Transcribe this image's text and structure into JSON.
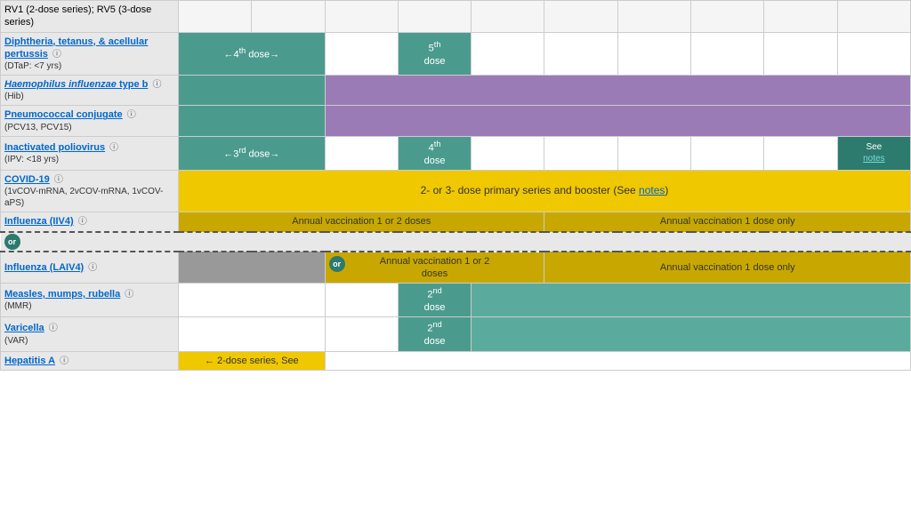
{
  "rows": [
    {
      "id": "rv",
      "nameHtml": "RV1 (2-dose series); RV5 (3-dose series)",
      "nameLink": false,
      "cells": []
    },
    {
      "id": "dtap",
      "nameLink": "Diphtheria, tetanus, & acellular pertussis",
      "nameSub": "(DTaP: <7 yrs)",
      "infoIcon": true,
      "cells": [
        {
          "col": 2,
          "colspan": 2,
          "text": "←4th dose→",
          "class": "teal"
        },
        {
          "col": 4,
          "colspan": 1,
          "text": "",
          "class": "white-cell"
        },
        {
          "col": 5,
          "colspan": 1,
          "text": "5th\ndose",
          "class": "teal"
        },
        {
          "col": 6,
          "colspan": 5,
          "text": "",
          "class": "white-cell"
        }
      ]
    },
    {
      "id": "hib",
      "nameLink": "Haemophilus influenzae type b",
      "nameSub": "(Hib)",
      "infoIcon": true,
      "cells": [
        {
          "col": 2,
          "colspan": 2,
          "text": "",
          "class": "teal"
        },
        {
          "col": 4,
          "colspan": 7,
          "text": "",
          "class": "purple"
        }
      ]
    },
    {
      "id": "pcv",
      "nameLink": "Pneumococcal conjugate",
      "nameSub": "(PCV13, PCV15)",
      "infoIcon": true,
      "cells": [
        {
          "col": 2,
          "colspan": 2,
          "text": "",
          "class": "teal"
        },
        {
          "col": 4,
          "colspan": 7,
          "text": "",
          "class": "purple"
        }
      ]
    },
    {
      "id": "ipv",
      "nameLink": "Inactivated poliovirus",
      "nameSub": "(IPV: <18 yrs)",
      "infoIcon": true,
      "cells": [
        {
          "col": 2,
          "colspan": 2,
          "text": "←3rd dose→",
          "class": "teal"
        },
        {
          "col": 4,
          "colspan": 1,
          "text": "",
          "class": "white-cell"
        },
        {
          "col": 5,
          "colspan": 1,
          "text": "4th\ndose",
          "class": "teal"
        },
        {
          "col": 6,
          "colspan": 4,
          "text": "",
          "class": "white-cell"
        },
        {
          "col": 10,
          "colspan": 1,
          "text": "See\nnotes",
          "class": "teal-dark see-notes-cell"
        }
      ]
    },
    {
      "id": "covid",
      "nameLink": "COVID-19",
      "nameSub": "(1vCOV-mRNA, 2vCOV-mRNA, 1vCOV-aPS)",
      "infoIcon": true,
      "cells": [
        {
          "col": 2,
          "colspan": 9,
          "text": "2- or 3- dose primary series and booster (See notes)",
          "class": "yellow"
        }
      ]
    },
    {
      "id": "influenza-iiv4",
      "nameLink": "Influenza (IIV4)",
      "nameSub": "",
      "infoIcon": true,
      "dotted_bottom": true,
      "cells": [
        {
          "col": 2,
          "colspan": 5,
          "text": "Annual vaccination 1 or 2 doses",
          "class": "yellow-dark"
        },
        {
          "col": 7,
          "colspan": 4,
          "text": "Annual vaccination 1 dose only",
          "class": "yellow-dark"
        }
      ]
    },
    {
      "id": "or-row",
      "isOr": true
    },
    {
      "id": "influenza-laiv4",
      "nameLink": "Influenza (LAIV4)",
      "nameSub": "",
      "infoIcon": true,
      "dotted_top": true,
      "cells": [
        {
          "col": 2,
          "colspan": 2,
          "text": "",
          "class": "gray"
        },
        {
          "col": 4,
          "colspan": 3,
          "text": "Annual vaccination 1 or 2\ndoses",
          "class": "yellow-dark",
          "orBadge": true
        },
        {
          "col": 7,
          "colspan": 4,
          "text": "Annual vaccination 1 dose only",
          "class": "yellow-dark"
        }
      ]
    },
    {
      "id": "mmr",
      "nameLink": "Measles, mumps, rubella",
      "nameSub": "(MMR)",
      "infoIcon": true,
      "cells": [
        {
          "col": 2,
          "colspan": 2,
          "text": "",
          "class": "white-cell"
        },
        {
          "col": 4,
          "colspan": 1,
          "text": "",
          "class": "white-cell"
        },
        {
          "col": 5,
          "colspan": 1,
          "text": "2nd\ndose",
          "class": "teal"
        },
        {
          "col": 6,
          "colspan": 5,
          "text": "",
          "class": "teal-light"
        }
      ]
    },
    {
      "id": "varicella",
      "nameLink": "Varicella",
      "nameSub": "(VAR)",
      "infoIcon": true,
      "cells": [
        {
          "col": 2,
          "colspan": 2,
          "text": "",
          "class": "white-cell"
        },
        {
          "col": 4,
          "colspan": 1,
          "text": "",
          "class": "white-cell"
        },
        {
          "col": 5,
          "colspan": 1,
          "text": "2nd\ndose",
          "class": "teal"
        },
        {
          "col": 6,
          "colspan": 5,
          "text": "",
          "class": "teal-light"
        }
      ]
    },
    {
      "id": "hepa",
      "nameLink": "Hepatitis A",
      "nameSub": "",
      "infoIcon": true,
      "cells": [
        {
          "col": 2,
          "colspan": 2,
          "text": "← 2-dose series, See",
          "class": "yellow"
        }
      ]
    }
  ],
  "colors": {
    "teal": "#4a9e8e",
    "teal_dark": "#2d6b5e",
    "yellow": "#f0c800",
    "yellow_dark": "#c8a200",
    "purple": "#9b78b5",
    "gray": "#999999"
  },
  "labels": {
    "covid_text": "2- or 3- dose primary series and booster (See notes)",
    "see_notes": "See\nnotes",
    "hepa_text": "← 2-dose series, See",
    "iiv4_left": "Annual vaccination 1 or 2 doses",
    "iiv4_right": "Annual vaccination 1 dose only",
    "laiv4_mid": "Annual vaccination 1 or 2\ndoses",
    "laiv4_right": "Annual vaccination 1 dose only"
  }
}
